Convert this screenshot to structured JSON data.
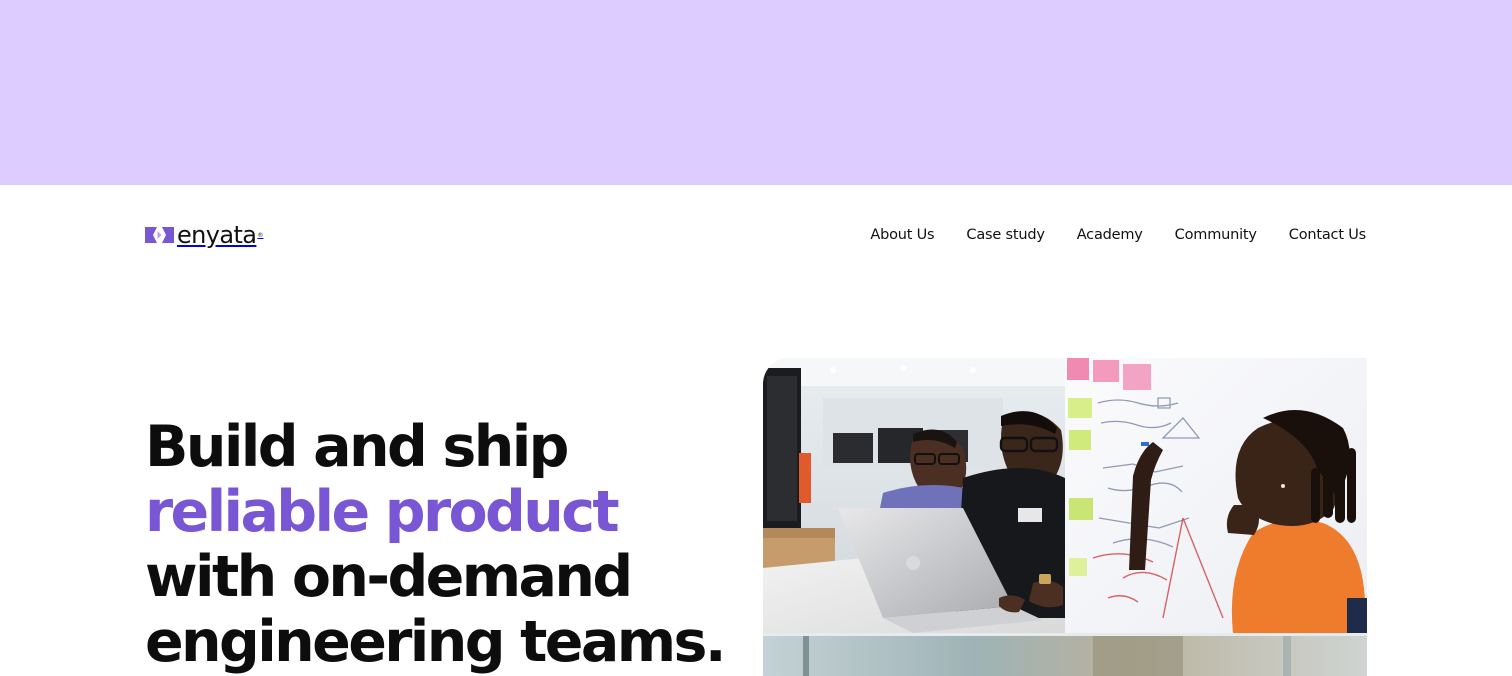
{
  "brand": {
    "name": "enyata",
    "mark_icon": "enyata-logo-mark",
    "accent_color": "#7856D4",
    "banner_color": "#DDCCFF"
  },
  "nav": {
    "items": [
      {
        "label": "About Us"
      },
      {
        "label": "Case study"
      },
      {
        "label": "Academy"
      },
      {
        "label": "Community"
      },
      {
        "label": "Contact Us"
      }
    ]
  },
  "hero": {
    "line1": "Build and ship",
    "line2_accent": "reliable product",
    "line3": "with on-demand",
    "line4": "engineering teams."
  },
  "collage": {
    "photos": [
      {
        "name": "engineers-at-laptops-photo"
      },
      {
        "name": "whiteboard-planning-photo"
      },
      {
        "name": "office-photo"
      }
    ]
  }
}
